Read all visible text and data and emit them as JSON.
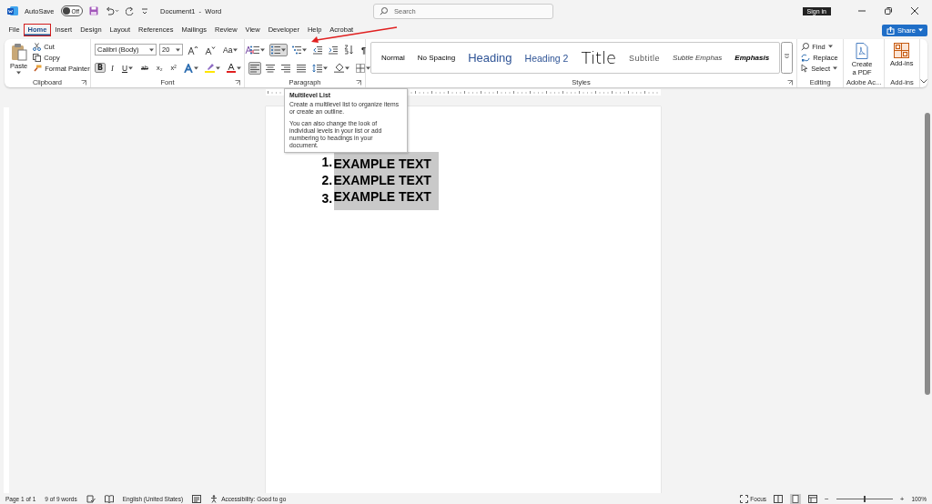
{
  "title_bar": {
    "autosave_label": "AutoSave",
    "autosave_toggle": {
      "label": "Off",
      "on": false
    },
    "document_title": "Document1  -  Word",
    "search": {
      "placeholder": "Search"
    },
    "sign_in": "Sign in"
  },
  "tabs": [
    {
      "label": "File",
      "selected": false,
      "annotated": false
    },
    {
      "label": "Home",
      "selected": true,
      "annotated": true
    },
    {
      "label": "Insert",
      "selected": false,
      "annotated": false
    },
    {
      "label": "Design",
      "selected": false,
      "annotated": false
    },
    {
      "label": "Layout",
      "selected": false,
      "annotated": false
    },
    {
      "label": "References",
      "selected": false,
      "annotated": false
    },
    {
      "label": "Mailings",
      "selected": false,
      "annotated": false
    },
    {
      "label": "Review",
      "selected": false,
      "annotated": false
    },
    {
      "label": "View",
      "selected": false,
      "annotated": false
    },
    {
      "label": "Developer",
      "selected": false,
      "annotated": false
    },
    {
      "label": "Help",
      "selected": false,
      "annotated": false
    },
    {
      "label": "Acrobat",
      "selected": false,
      "annotated": false
    }
  ],
  "share": "Share",
  "ribbon": {
    "clipboard": {
      "paste": "Paste",
      "cut": "Cut",
      "copy": "Copy",
      "format_painter": "Format Painter",
      "label": "Clipboard"
    },
    "font": {
      "font_name": "Calibri (Body)",
      "font_size": "20",
      "change_case": "Aa",
      "bold": {
        "label": "B",
        "on": true
      },
      "italic": "I",
      "underline": "U",
      "strikethrough": "ab",
      "subscript": "x₂",
      "superscript": "x²",
      "label": "Font"
    },
    "paragraph": {
      "numbering_on": true,
      "align_left_on": true,
      "show_marks": "¶",
      "label": "Paragraph"
    },
    "styles": {
      "items": [
        {
          "name": "Normal",
          "kind": "normal"
        },
        {
          "name": "No Spacing",
          "kind": "normal"
        },
        {
          "name": "Heading",
          "kind": "heading"
        },
        {
          "name": "Heading 2",
          "kind": "heading2"
        },
        {
          "name": "Title",
          "kind": "title"
        },
        {
          "name": "Subtitle",
          "kind": "subtitle"
        },
        {
          "name": "Subtle Emphas",
          "kind": "subtle"
        },
        {
          "name": "Emphasis",
          "kind": "emphasis"
        }
      ],
      "label": "Styles"
    },
    "editing": {
      "find": "Find",
      "replace": "Replace",
      "select": "Select",
      "label": "Editing"
    },
    "adobe": {
      "create_pdf": "Create a PDF",
      "label": "Adobe Ac..."
    },
    "addins": {
      "button": "Add-ins",
      "label": "Add-ins"
    }
  },
  "tooltip": {
    "title": "Multilevel List",
    "paragraphs": [
      "Create a multilevel list to organize items or create an outline.",
      "You can also change the look of individual levels in your list or add numbering to headings in your document."
    ]
  },
  "document": {
    "list": [
      {
        "number": "1.",
        "text": "EXAMPLE TEXT",
        "selected": true
      },
      {
        "number": "2.",
        "text": "EXAMPLE TEXT",
        "selected": true
      },
      {
        "number": "3.",
        "text": "EXAMPLE TEXT",
        "selected": true
      }
    ]
  },
  "status_bar": {
    "page": "Page 1 of 1",
    "words": "9 of 9 words",
    "language": "English (United States)",
    "accessibility": "Accessibility: Good to go",
    "focus": "Focus",
    "zoom_out": "−",
    "zoom_slider": {
      "level": 0.5
    },
    "zoom_in": "+",
    "zoom": "100%"
  }
}
